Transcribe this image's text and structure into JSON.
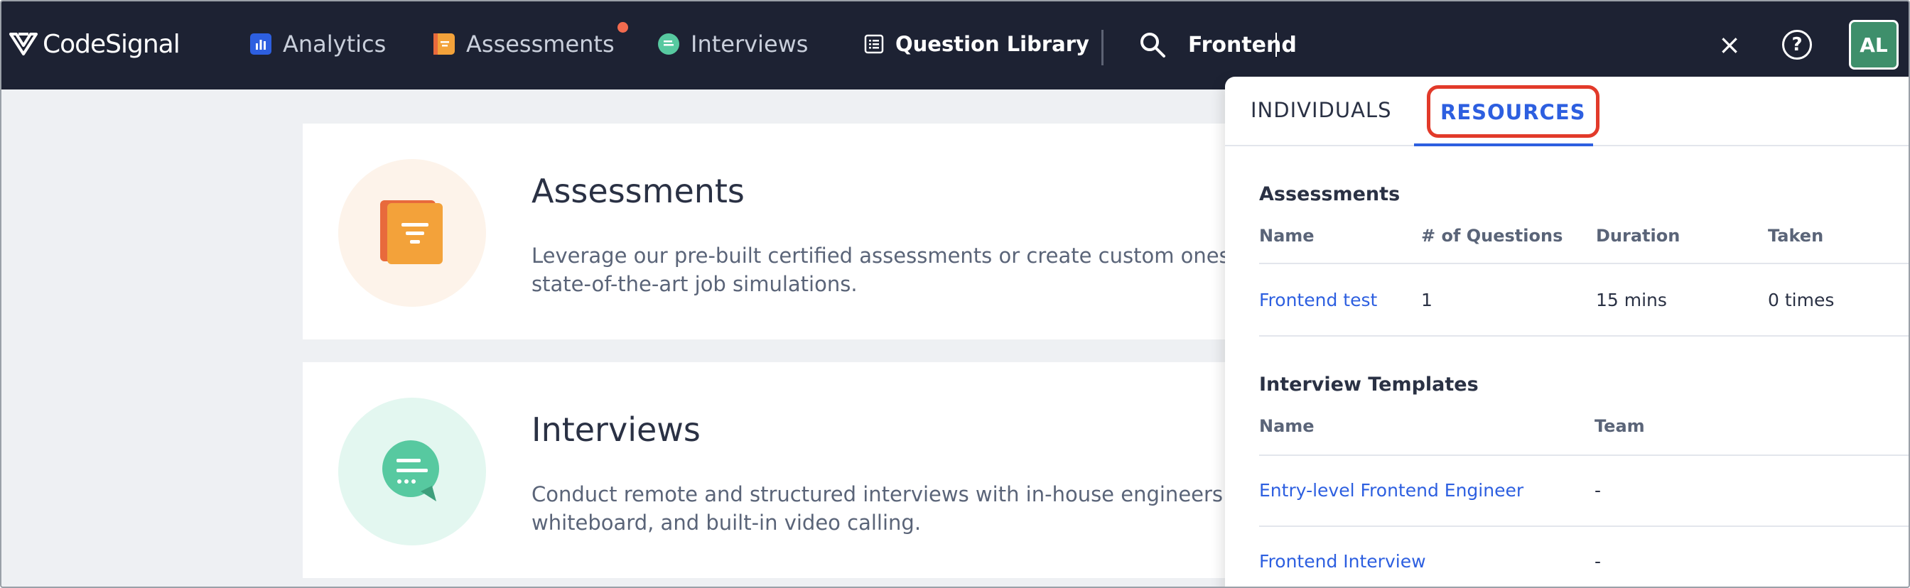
{
  "nav": {
    "brand": "CodeSignal",
    "items": [
      {
        "label": "Analytics"
      },
      {
        "label": "Assessments"
      },
      {
        "label": "Interviews"
      },
      {
        "label": "Question Library"
      }
    ],
    "search_value": "Frontend",
    "avatar_initials": "AL",
    "help_symbol": "?",
    "clear_symbol": "×"
  },
  "cards": [
    {
      "title": "Assessments",
      "description": "Leverage our pre-built certified assessments or create custom ones t using state-of-the-art job simulations."
    },
    {
      "title": "Interviews",
      "description": "Conduct remote and structured interviews with in-house engineers t whiteboard, and built-in video calling."
    }
  ],
  "dropdown": {
    "tabs": [
      {
        "label": "INDIVIDUALS",
        "active": false
      },
      {
        "label": "RESOURCES",
        "active": true
      }
    ],
    "assessments": {
      "title": "Assessments",
      "columns": [
        "Name",
        "# of Questions",
        "Duration",
        "Taken"
      ],
      "rows": [
        {
          "name": "Frontend test",
          "questions": "1",
          "duration": "15 mins",
          "taken": "0 times"
        }
      ]
    },
    "interview_templates": {
      "title": "Interview Templates",
      "columns": [
        "Name",
        "Team"
      ],
      "rows": [
        {
          "name": "Entry-level Frontend Engineer",
          "team": "-"
        },
        {
          "name": "Frontend Interview",
          "team": "-"
        }
      ]
    }
  },
  "colors": {
    "nav_bg": "#1d2233",
    "link_blue": "#2d5fe0",
    "highlight_red": "#e23a2a",
    "avatar_green": "#3e8f6b"
  },
  "icons": [
    "codesignal-logo-icon",
    "analytics-icon",
    "assessments-icon",
    "interviews-icon",
    "question-library-icon",
    "search-icon",
    "close-icon",
    "help-icon"
  ]
}
